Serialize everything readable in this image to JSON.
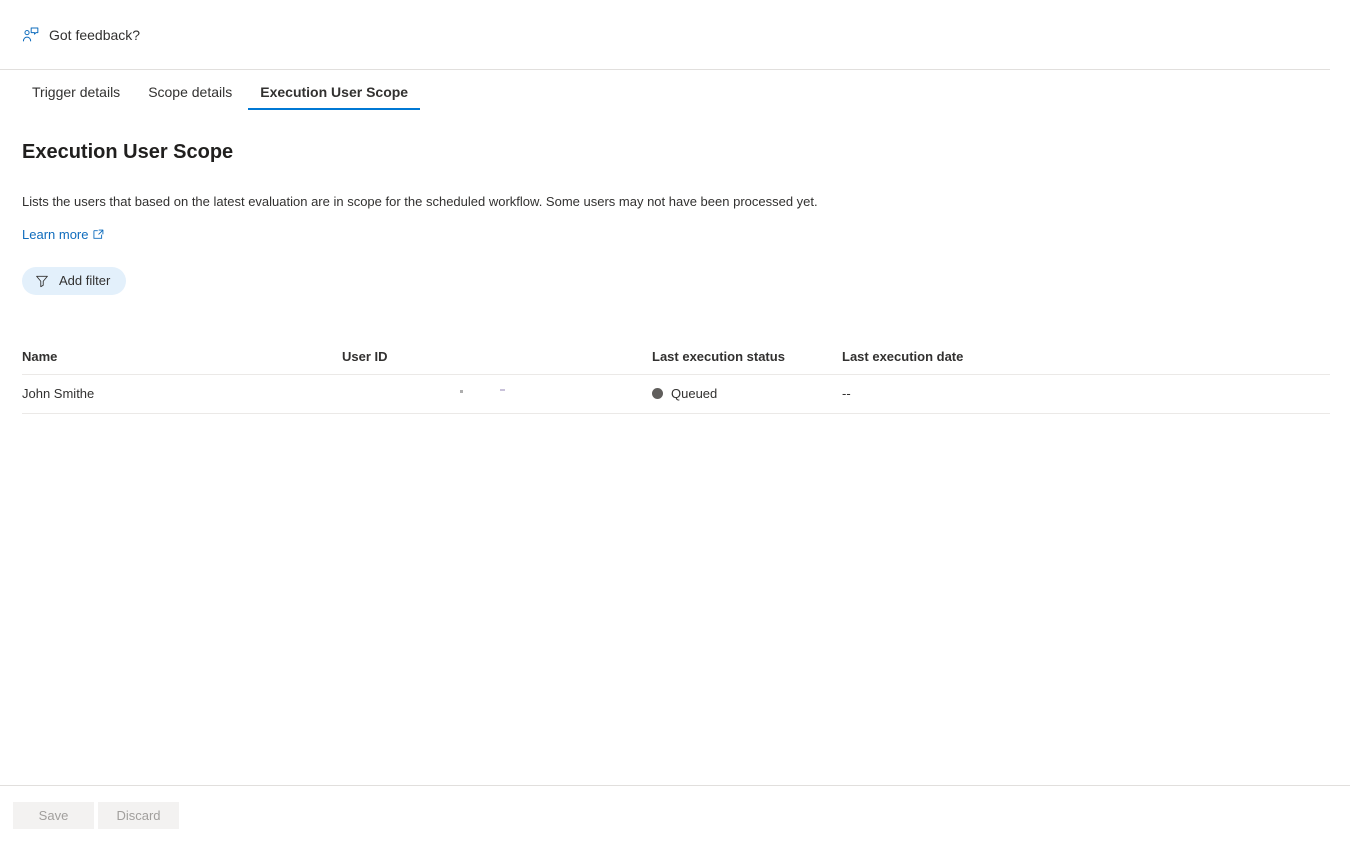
{
  "feedback": {
    "label": "Got feedback?",
    "icon": "person-feedback-icon"
  },
  "tabs": [
    {
      "label": "Trigger details",
      "active": false
    },
    {
      "label": "Scope details",
      "active": false
    },
    {
      "label": "Execution User Scope",
      "active": true
    }
  ],
  "page": {
    "title": "Execution User Scope",
    "description": "Lists the users that based on the latest evaluation are in scope for the scheduled workflow. Some users may not have been processed yet.",
    "learn_more_label": "Learn more",
    "learn_more_icon": "external-link-icon"
  },
  "toolbar": {
    "add_filter_label": "Add filter",
    "add_filter_icon": "funnel-icon"
  },
  "table": {
    "columns": [
      {
        "key": "name",
        "label": "Name"
      },
      {
        "key": "user_id",
        "label": "User ID"
      },
      {
        "key": "status",
        "label": "Last execution status"
      },
      {
        "key": "date",
        "label": "Last execution date"
      }
    ],
    "rows": [
      {
        "name": "John Smithe",
        "user_id": "",
        "status": "Queued",
        "status_color": "#605e5c",
        "date": "--"
      }
    ]
  },
  "footer": {
    "save_label": "Save",
    "discard_label": "Discard"
  },
  "colors": {
    "accent": "#0078d4",
    "link": "#0f6cbd",
    "filter_pill": "#e3f0fb",
    "border": "#e1dfdd",
    "table_border": "#ebe9e7",
    "disabled_button_bg": "#f3f2f1",
    "disabled_button_text": "#a19f9d"
  }
}
